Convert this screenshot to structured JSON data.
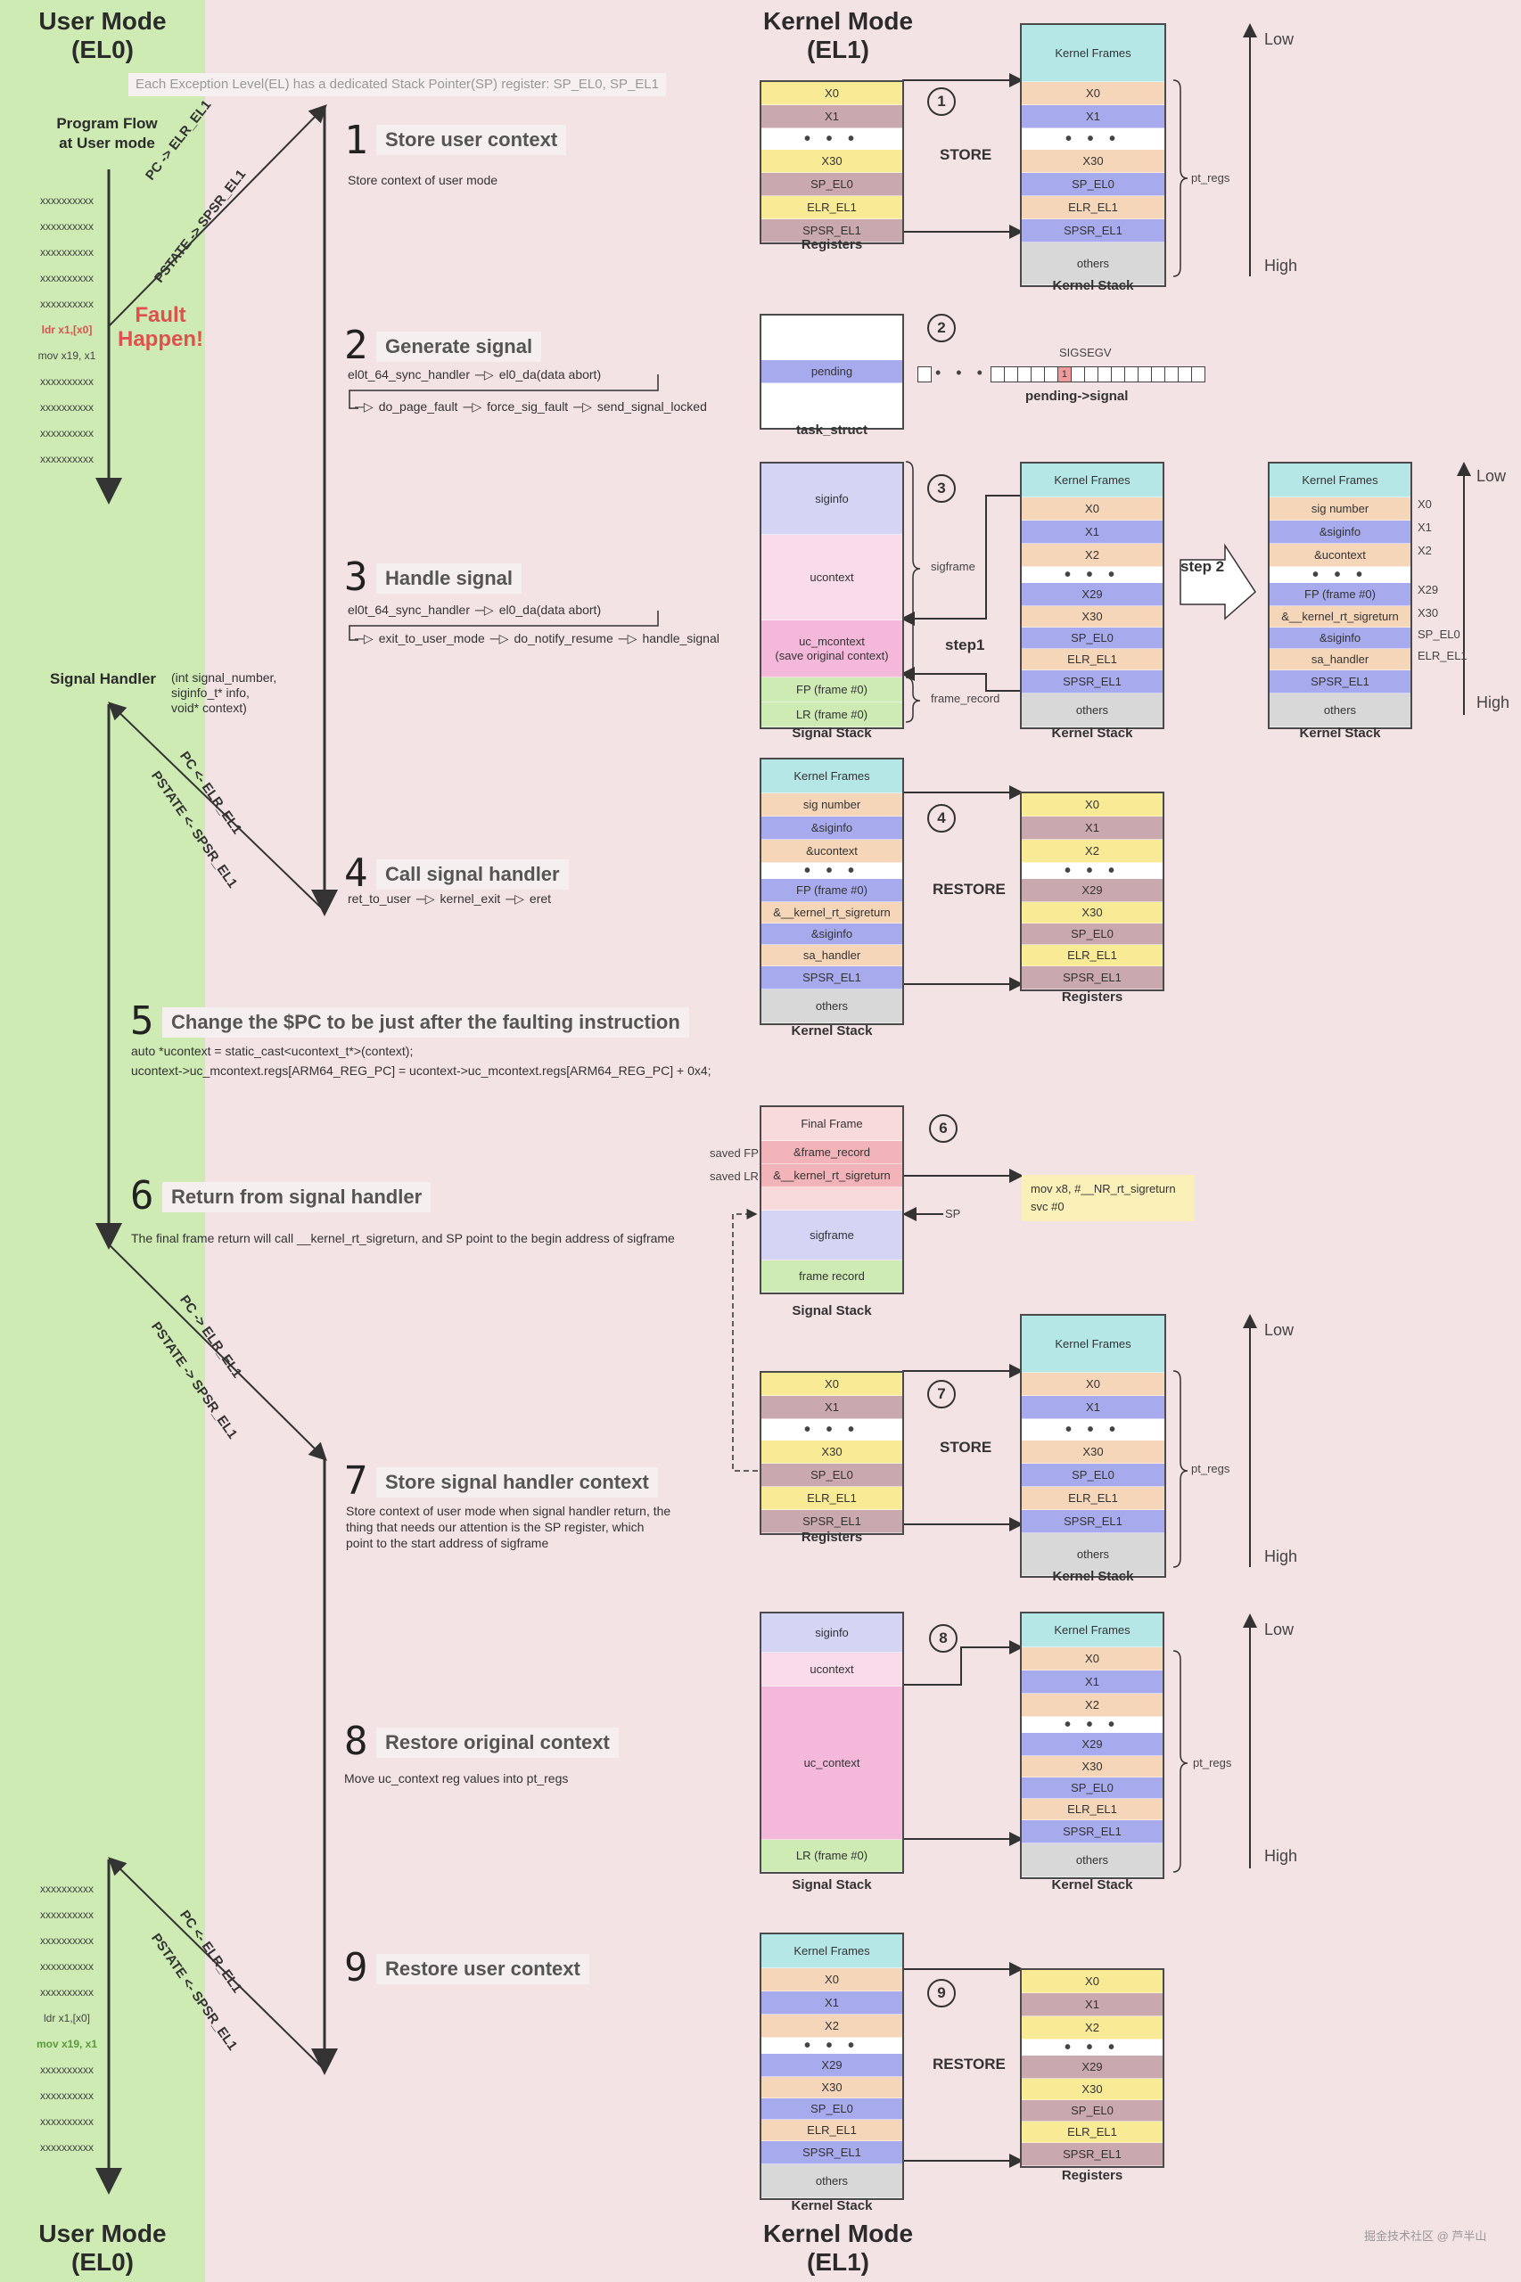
{
  "colors": {
    "user_zone": "#cdebb3",
    "kernel_zone": "#f3e3e5",
    "fault_red": "#e05050",
    "next_green": "#5a9a3a",
    "reg_yellow": "#f9eb96",
    "reg_mauve": "#c9a9ae",
    "stack_peach": "#f6d6b8",
    "stack_blue": "#a8aaee",
    "kernel_frames_cyan": "#b5e7e7",
    "others_gray": "#d8d8d8"
  },
  "header": {
    "user_mode": "User Mode",
    "user_mode_el": "(EL0)",
    "kernel_mode": "Kernel Mode",
    "kernel_mode_el": "(EL1)",
    "banner": "Each Exception Level(EL) has a dedicated Stack Pointer(SP) register: SP_EL0, SP_EL1"
  },
  "footer": {
    "user_mode": "User Mode",
    "user_mode_el": "(EL0)",
    "kernel_mode": "Kernel Mode",
    "kernel_mode_el": "(EL1)",
    "watermark": "掘金技术社区 @ 芦半山"
  },
  "user_side": {
    "flow_title_1": "Program Flow",
    "flow_title_2": "at User mode",
    "code_top": [
      "xxxxxxxxxx",
      "xxxxxxxxxx",
      "xxxxxxxxxx",
      "xxxxxxxxxx",
      "xxxxxxxxxx",
      "ldr  x1,[x0]",
      "mov x19, x1",
      "xxxxxxxxxx",
      "xxxxxxxxxx",
      "xxxxxxxxxx",
      "xxxxxxxxxx"
    ],
    "fault_1": "Fault",
    "fault_2": "Happen!",
    "signal_handler": "Signal Handler",
    "signal_handler_args": [
      "(int signal_number,",
      "siginfo_t* info,",
      "void* context)"
    ],
    "code_bottom": [
      "xxxxxxxxxx",
      "xxxxxxxxxx",
      "xxxxxxxxxx",
      "xxxxxxxxxx",
      "xxxxxxxxxx",
      "ldr  x1,[x0]",
      "mov x19, x1",
      "xxxxxxxxxx",
      "xxxxxxxxxx",
      "xxxxxxxxxx",
      "xxxxxxxxxx"
    ],
    "transitions": {
      "enter_pc": "PC -> ELR_EL1",
      "enter_pstate": "PSTATE -> SPSR_EL1",
      "exit_pc": "PC <- ELR_EL1",
      "exit_pstate": "PSTATE <- SPSR_EL1"
    }
  },
  "steps": [
    {
      "num": "1",
      "title": "Store user context",
      "desc": "Store context of user mode"
    },
    {
      "num": "2",
      "title": "Generate signal",
      "chain1": [
        "el0t_64_sync_handler",
        "el0_da(data abort)"
      ],
      "chain2": [
        "do_page_fault",
        "force_sig_fault",
        "send_signal_locked"
      ]
    },
    {
      "num": "3",
      "title": "Handle signal",
      "chain1": [
        "el0t_64_sync_handler",
        "el0_da(data abort)"
      ],
      "chain2": [
        "exit_to_user_mode",
        "do_notify_resume",
        "handle_signal"
      ]
    },
    {
      "num": "4",
      "title": "Call signal handler",
      "chain1": [
        "ret_to_user",
        "kernel_exit",
        "eret"
      ]
    },
    {
      "num": "5",
      "title": "Change the $PC to be just after the faulting instruction",
      "code": [
        "auto *ucontext = static_cast<ucontext_t*>(context);",
        "ucontext->uc_mcontext.regs[ARM64_REG_PC] = ucontext->uc_mcontext.regs[ARM64_REG_PC] + 0x4;"
      ]
    },
    {
      "num": "6",
      "title": "Return from signal handler",
      "desc": "The final frame return will call __kernel_rt_sigreturn, and SP point to the begin address of sigframe"
    },
    {
      "num": "7",
      "title": "Store signal handler context",
      "desc": [
        "Store context of user mode when signal handler return, the",
        "thing that needs our attention is the SP register, which",
        "point to the start address of sigframe"
      ]
    },
    {
      "num": "8",
      "title": "Restore original context",
      "desc": "Move uc_context reg values into pt_regs"
    },
    {
      "num": "9",
      "title": "Restore user context"
    }
  ],
  "diagrams": {
    "d1": {
      "circle": "1",
      "op": "STORE",
      "registers": [
        "X0",
        "X1",
        "• • •",
        "X30",
        "SP_EL0",
        "ELR_EL1",
        "SPSR_EL1"
      ],
      "registers_label": "Registers",
      "kernel_stack": [
        "Kernel Frames",
        "X0",
        "X1",
        "• • •",
        "X30",
        "SP_EL0",
        "ELR_EL1",
        "SPSR_EL1",
        "others"
      ],
      "kernel_stack_label": "Kernel Stack",
      "brace": "pt_regs",
      "low": "Low",
      "high": "High"
    },
    "d2": {
      "circle": "2",
      "task_struct": [
        "",
        "pending",
        ""
      ],
      "task_struct_label": "task_struct",
      "sig_label": "SIGSEGV",
      "bit_set_value": "1",
      "bits_label": "pending->signal"
    },
    "d3": {
      "circle": "3",
      "signal_stack": [
        "siginfo",
        "ucontext",
        "uc_mcontext\n(save original context)",
        "FP (frame #0)",
        "LR (frame #0)"
      ],
      "signal_stack_label": "Signal Stack",
      "brace_sigframe": "sigframe",
      "brace_frame_record": "frame_record",
      "step1": "step1",
      "step2": "step 2",
      "kernel_stack": [
        "Kernel Frames",
        "X0",
        "X1",
        "X2",
        "• • •",
        "X29",
        "X30",
        "SP_EL0",
        "ELR_EL1",
        "SPSR_EL1",
        "others"
      ],
      "kernel_stack_after": [
        "Kernel Frames",
        "sig number",
        "&siginfo",
        "&ucontext",
        "• • •",
        "FP (frame #0)",
        "&__kernel_rt_sigreturn",
        "&siginfo",
        "sa_handler",
        "SPSR_EL1",
        "others"
      ],
      "reg_map": [
        "X0",
        "X1",
        "X2",
        "",
        "X29",
        "X30",
        "SP_EL0",
        "ELR_EL1",
        ""
      ],
      "kernel_stack_label": "Kernel Stack",
      "low": "Low",
      "high": "High"
    },
    "d4": {
      "circle": "4",
      "op": "RESTORE",
      "kernel_stack": [
        "Kernel Frames",
        "sig number",
        "&siginfo",
        "&ucontext",
        "• • •",
        "FP (frame #0)",
        "&__kernel_rt_sigreturn",
        "&siginfo",
        "sa_handler",
        "SPSR_EL1",
        "others"
      ],
      "kernel_stack_label": "Kernel Stack",
      "registers": [
        "X0",
        "X1",
        "X2",
        "• • •",
        "X29",
        "X30",
        "SP_EL0",
        "ELR_EL1",
        "SPSR_EL1"
      ],
      "registers_label": "Registers"
    },
    "d6": {
      "circle": "6",
      "signal_stack": [
        "Final Frame",
        "&frame_record",
        "&__kernel_rt_sigreturn",
        "",
        "sigframe",
        "frame record"
      ],
      "saved_fp": "saved FP",
      "saved_lr": "saved LR",
      "sp": "SP",
      "signal_stack_label": "Signal Stack",
      "note": [
        "mov  x8, #__NR_rt_sigreturn",
        "svc  #0"
      ]
    },
    "d7": {
      "circle": "7",
      "op": "STORE",
      "registers": [
        "X0",
        "X1",
        "• • •",
        "X30",
        "SP_EL0",
        "ELR_EL1",
        "SPSR_EL1"
      ],
      "registers_label": "Registers",
      "kernel_stack": [
        "Kernel Frames",
        "X0",
        "X1",
        "• • •",
        "X30",
        "SP_EL0",
        "ELR_EL1",
        "SPSR_EL1",
        "others"
      ],
      "kernel_stack_label": "Kernel Stack",
      "brace": "pt_regs",
      "low": "Low",
      "high": "High"
    },
    "d8": {
      "circle": "8",
      "signal_stack": [
        "siginfo",
        "ucontext",
        "uc_context",
        "LR (frame #0)"
      ],
      "signal_stack_label": "Signal Stack",
      "kernel_stack": [
        "Kernel Frames",
        "X0",
        "X1",
        "X2",
        "• • •",
        "X29",
        "X30",
        "SP_EL0",
        "ELR_EL1",
        "SPSR_EL1",
        "others"
      ],
      "kernel_stack_label": "Kernel Stack",
      "brace": "pt_regs",
      "low": "Low",
      "high": "High"
    },
    "d9": {
      "circle": "9",
      "op": "RESTORE",
      "kernel_stack": [
        "Kernel Frames",
        "X0",
        "X1",
        "X2",
        "• • •",
        "X29",
        "X30",
        "SP_EL0",
        "ELR_EL1",
        "SPSR_EL1",
        "others"
      ],
      "kernel_stack_label": "Kernel Stack",
      "registers": [
        "X0",
        "X1",
        "X2",
        "• • •",
        "X29",
        "X30",
        "SP_EL0",
        "ELR_EL1",
        "SPSR_EL1"
      ],
      "registers_label": "Registers"
    }
  }
}
